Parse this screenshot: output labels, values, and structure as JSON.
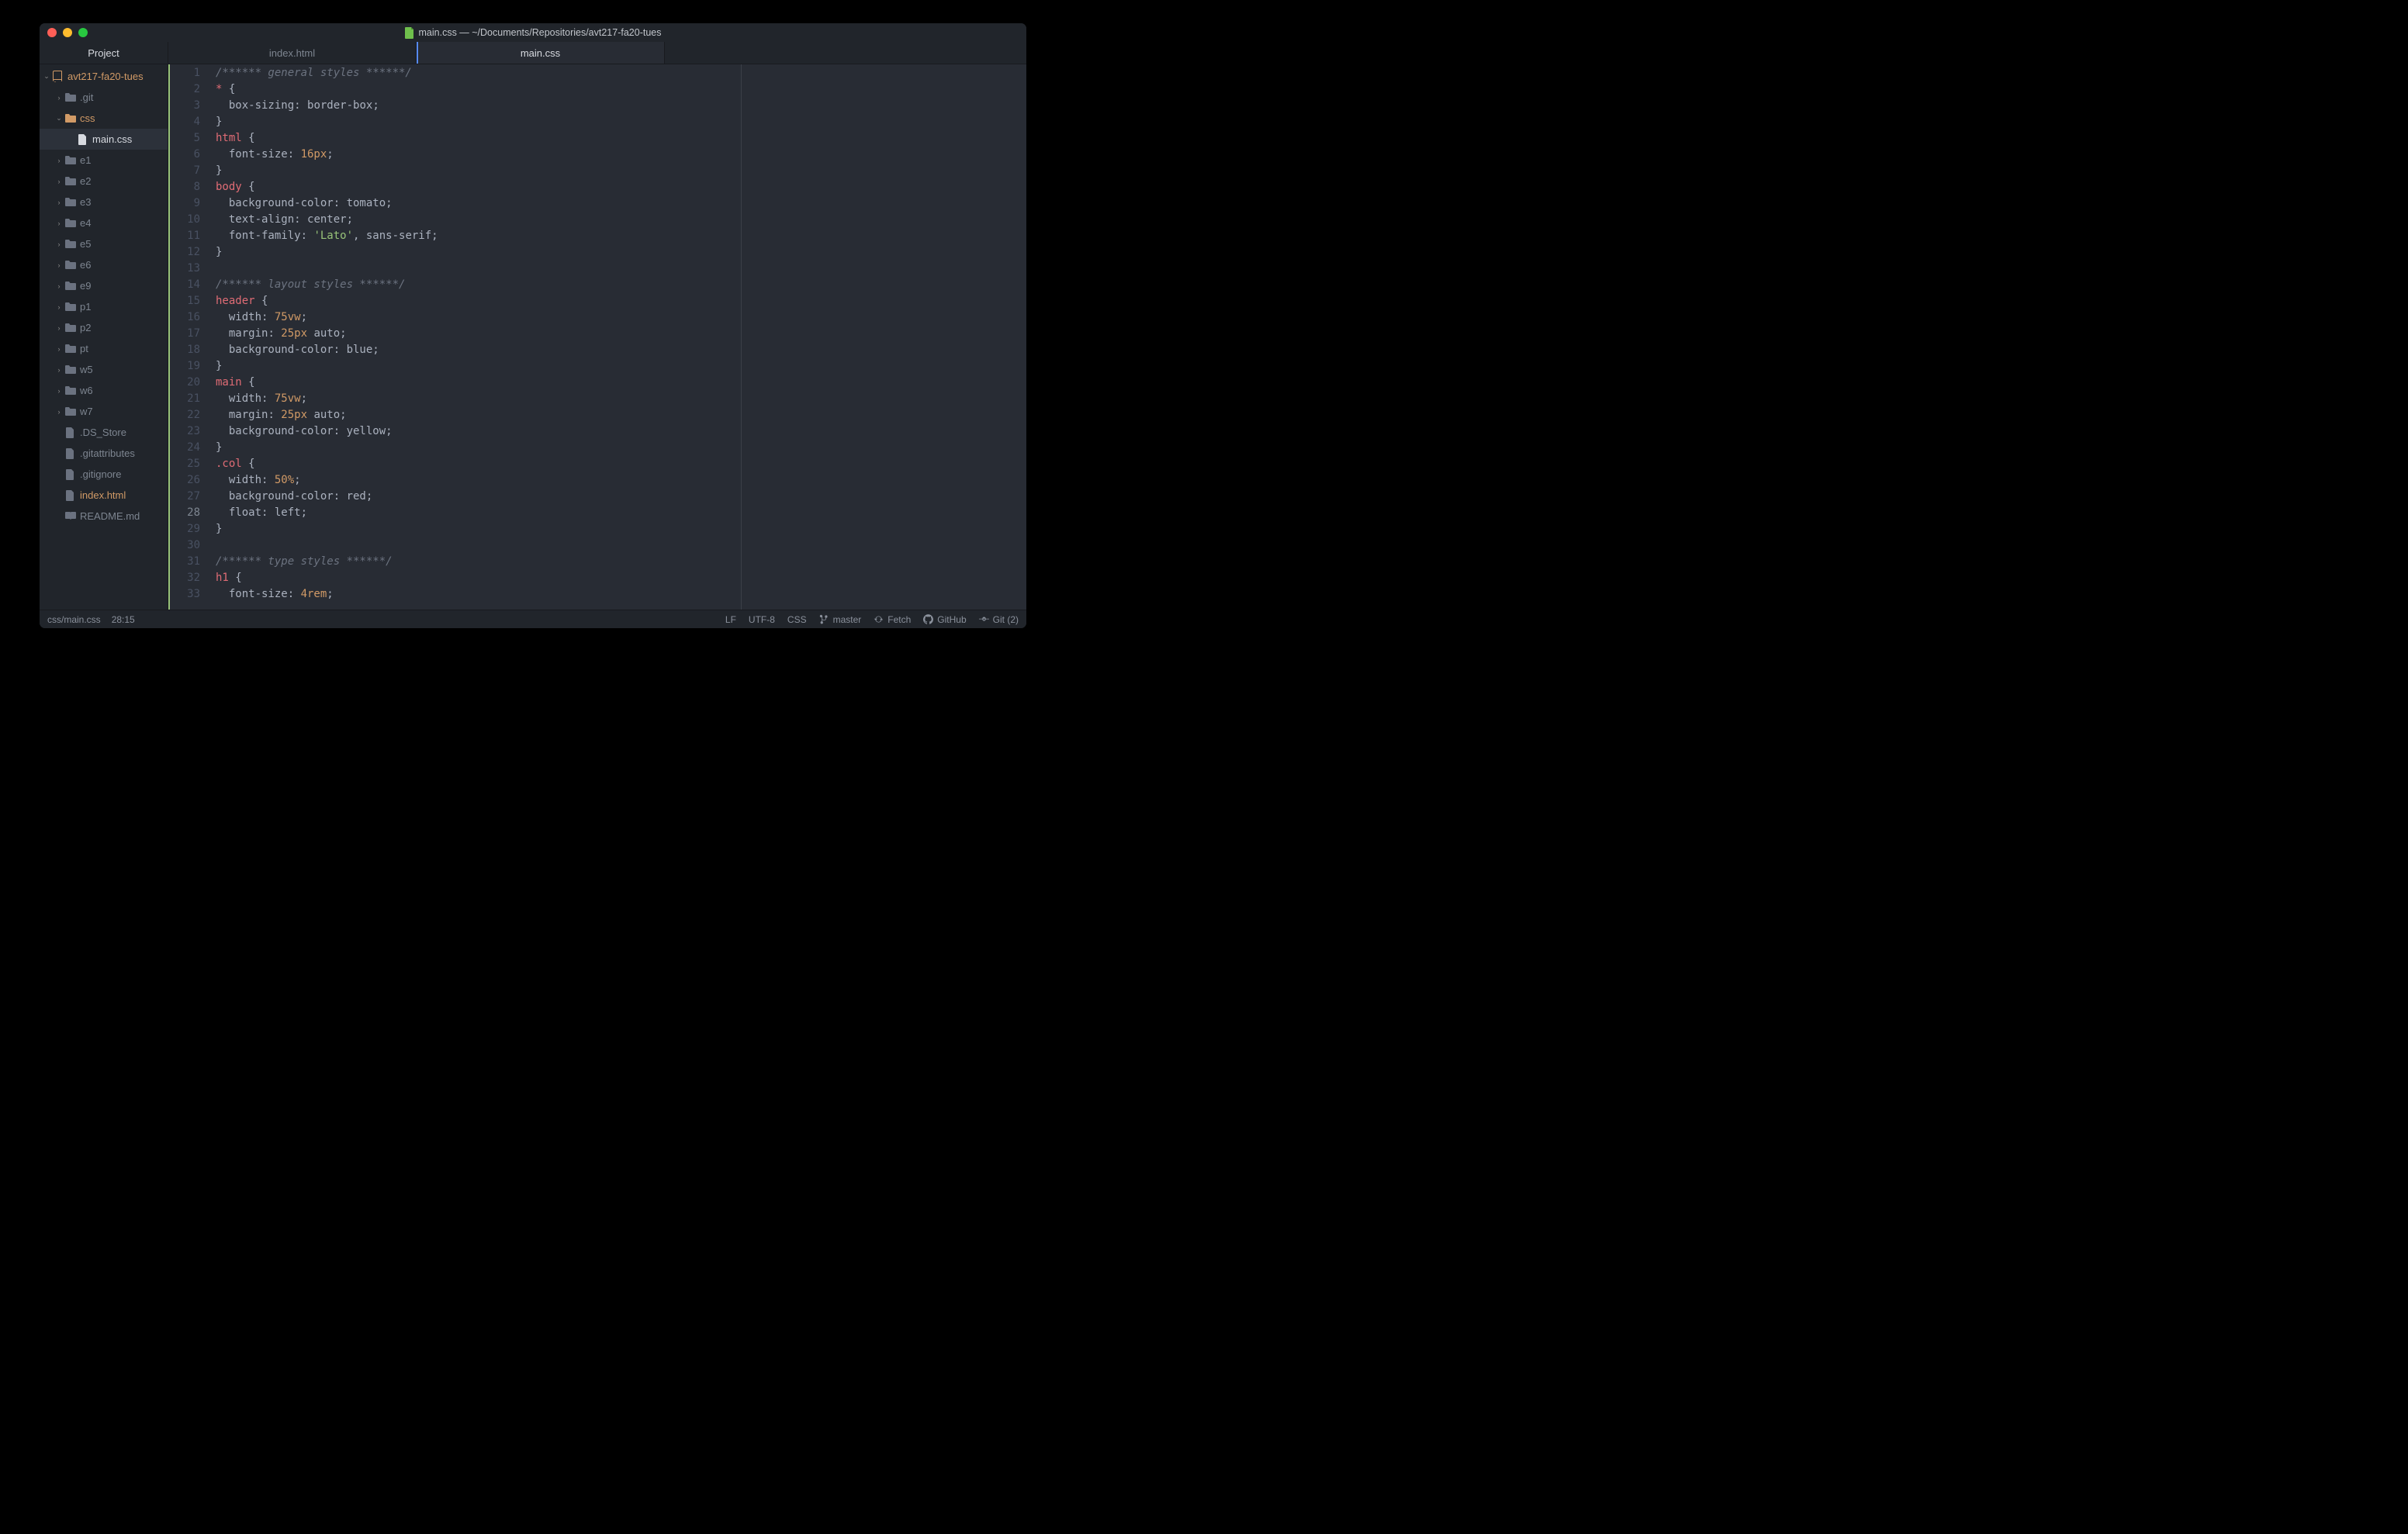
{
  "window": {
    "title": "main.css — ~/Documents/Repositories/avt217-fa20-tues"
  },
  "sidebar": {
    "header": "Project",
    "tree": [
      {
        "depth": 0,
        "type": "repo",
        "label": "avt217-fa20-tues",
        "expanded": true,
        "color": "orange"
      },
      {
        "depth": 1,
        "type": "folder",
        "label": ".git",
        "expanded": false
      },
      {
        "depth": 1,
        "type": "folder",
        "label": "css",
        "expanded": true,
        "color": "orange"
      },
      {
        "depth": 2,
        "type": "file",
        "label": "main.css",
        "selected": true
      },
      {
        "depth": 1,
        "type": "folder",
        "label": "e1",
        "expanded": false
      },
      {
        "depth": 1,
        "type": "folder",
        "label": "e2",
        "expanded": false
      },
      {
        "depth": 1,
        "type": "folder",
        "label": "e3",
        "expanded": false
      },
      {
        "depth": 1,
        "type": "folder",
        "label": "e4",
        "expanded": false
      },
      {
        "depth": 1,
        "type": "folder",
        "label": "e5",
        "expanded": false
      },
      {
        "depth": 1,
        "type": "folder",
        "label": "e6",
        "expanded": false
      },
      {
        "depth": 1,
        "type": "folder",
        "label": "e9",
        "expanded": false
      },
      {
        "depth": 1,
        "type": "folder",
        "label": "p1",
        "expanded": false
      },
      {
        "depth": 1,
        "type": "folder",
        "label": "p2",
        "expanded": false
      },
      {
        "depth": 1,
        "type": "folder",
        "label": "pt",
        "expanded": false
      },
      {
        "depth": 1,
        "type": "folder",
        "label": "w5",
        "expanded": false
      },
      {
        "depth": 1,
        "type": "folder",
        "label": "w6",
        "expanded": false
      },
      {
        "depth": 1,
        "type": "folder",
        "label": "w7",
        "expanded": false
      },
      {
        "depth": 1,
        "type": "file",
        "label": ".DS_Store"
      },
      {
        "depth": 1,
        "type": "file",
        "label": ".gitattributes"
      },
      {
        "depth": 1,
        "type": "file",
        "label": ".gitignore"
      },
      {
        "depth": 1,
        "type": "file",
        "label": "index.html",
        "color": "orange"
      },
      {
        "depth": 1,
        "type": "readme",
        "label": "README.md"
      }
    ]
  },
  "tabs": [
    {
      "label": "index.html",
      "active": false
    },
    {
      "label": "main.css",
      "active": true
    }
  ],
  "code": {
    "start": 1,
    "cursor_line": 28,
    "lines": [
      [
        [
          "comment",
          "/****** general styles ******/"
        ]
      ],
      [
        [
          "sel",
          "*"
        ],
        [
          "punct",
          " {"
        ]
      ],
      [
        [
          "prop",
          "  box-sizing"
        ],
        [
          "punct",
          ": "
        ],
        [
          "val",
          "border-box"
        ],
        [
          "punct",
          ";"
        ]
      ],
      [
        [
          "punct",
          "}"
        ]
      ],
      [
        [
          "sel",
          "html"
        ],
        [
          "punct",
          " {"
        ]
      ],
      [
        [
          "prop",
          "  font-size"
        ],
        [
          "punct",
          ": "
        ],
        [
          "num",
          "16px"
        ],
        [
          "punct",
          ";"
        ]
      ],
      [
        [
          "punct",
          "}"
        ]
      ],
      [
        [
          "sel",
          "body"
        ],
        [
          "punct",
          " {"
        ]
      ],
      [
        [
          "prop",
          "  background-color"
        ],
        [
          "punct",
          ": "
        ],
        [
          "val",
          "tomato"
        ],
        [
          "punct",
          ";"
        ]
      ],
      [
        [
          "prop",
          "  text-align"
        ],
        [
          "punct",
          ": "
        ],
        [
          "val",
          "center"
        ],
        [
          "punct",
          ";"
        ]
      ],
      [
        [
          "prop",
          "  font-family"
        ],
        [
          "punct",
          ": "
        ],
        [
          "str",
          "'Lato'"
        ],
        [
          "punct",
          ", "
        ],
        [
          "val",
          "sans-serif"
        ],
        [
          "punct",
          ";"
        ]
      ],
      [
        [
          "punct",
          "}"
        ]
      ],
      [],
      [
        [
          "comment",
          "/****** layout styles ******/"
        ]
      ],
      [
        [
          "sel",
          "header"
        ],
        [
          "punct",
          " {"
        ]
      ],
      [
        [
          "prop",
          "  width"
        ],
        [
          "punct",
          ": "
        ],
        [
          "num",
          "75vw"
        ],
        [
          "punct",
          ";"
        ]
      ],
      [
        [
          "prop",
          "  margin"
        ],
        [
          "punct",
          ": "
        ],
        [
          "num",
          "25px"
        ],
        [
          "val",
          " auto"
        ],
        [
          "punct",
          ";"
        ]
      ],
      [
        [
          "prop",
          "  background-color"
        ],
        [
          "punct",
          ": "
        ],
        [
          "val",
          "blue"
        ],
        [
          "punct",
          ";"
        ]
      ],
      [
        [
          "punct",
          "}"
        ]
      ],
      [
        [
          "sel",
          "main"
        ],
        [
          "punct",
          " {"
        ]
      ],
      [
        [
          "prop",
          "  width"
        ],
        [
          "punct",
          ": "
        ],
        [
          "num",
          "75vw"
        ],
        [
          "punct",
          ";"
        ]
      ],
      [
        [
          "prop",
          "  margin"
        ],
        [
          "punct",
          ": "
        ],
        [
          "num",
          "25px"
        ],
        [
          "val",
          " auto"
        ],
        [
          "punct",
          ";"
        ]
      ],
      [
        [
          "prop",
          "  background-color"
        ],
        [
          "punct",
          ": "
        ],
        [
          "val",
          "yellow"
        ],
        [
          "punct",
          ";"
        ]
      ],
      [
        [
          "punct",
          "}"
        ]
      ],
      [
        [
          "sel",
          ".col"
        ],
        [
          "punct",
          " {"
        ]
      ],
      [
        [
          "prop",
          "  width"
        ],
        [
          "punct",
          ": "
        ],
        [
          "num",
          "50%"
        ],
        [
          "punct",
          ";"
        ]
      ],
      [
        [
          "prop",
          "  background-color"
        ],
        [
          "punct",
          ": "
        ],
        [
          "val",
          "red"
        ],
        [
          "punct",
          ";"
        ]
      ],
      [
        [
          "prop",
          "  float"
        ],
        [
          "punct",
          ": "
        ],
        [
          "val",
          "left"
        ],
        [
          "punct",
          ";"
        ]
      ],
      [
        [
          "punct",
          "}"
        ]
      ],
      [],
      [
        [
          "comment",
          "/****** type styles ******/"
        ]
      ],
      [
        [
          "sel",
          "h1"
        ],
        [
          "punct",
          " {"
        ]
      ],
      [
        [
          "prop",
          "  font-size"
        ],
        [
          "punct",
          ": "
        ],
        [
          "num",
          "4rem"
        ],
        [
          "punct",
          ";"
        ]
      ]
    ]
  },
  "statusbar": {
    "path": "css/main.css",
    "cursor": "28:15",
    "line_ending": "LF",
    "encoding": "UTF-8",
    "grammar": "CSS",
    "branch": "master",
    "fetch": "Fetch",
    "github": "GitHub",
    "git": "Git (2)"
  }
}
